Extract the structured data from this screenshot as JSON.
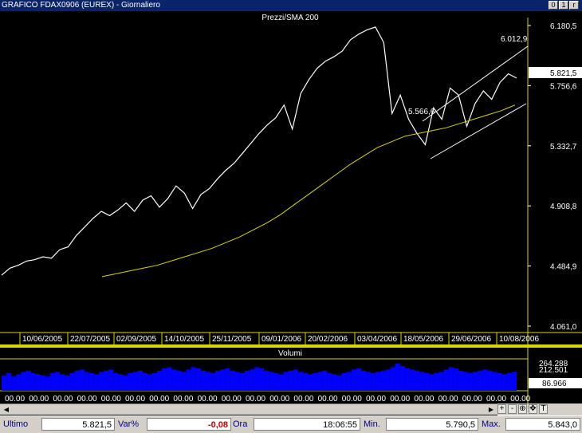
{
  "window": {
    "title": "GRAFICO FDAX0906 (EUREX) - Giornaliero",
    "buttons": [
      "0",
      "1",
      "r"
    ]
  },
  "chart_data": [
    {
      "type": "line",
      "title": "Prezzi/SMA 200",
      "series": [
        {
          "values": [
            4420,
            4470,
            4490,
            4520,
            4530,
            4550,
            4540,
            4600,
            4620,
            4700,
            4760,
            4820,
            4870,
            4840,
            4880,
            4930,
            4870,
            4950,
            4980,
            4900,
            4960,
            5050,
            5000,
            4890,
            4990,
            5030,
            5100,
            5160,
            5210,
            5280,
            5350,
            5420,
            5480,
            5530,
            5620,
            5450,
            5700,
            5800,
            5880,
            5930,
            5960,
            6000,
            6080,
            6120,
            6150,
            6170,
            6060,
            5560,
            5690,
            5520,
            5420,
            5340,
            5600,
            5520,
            5740,
            5690,
            5470,
            5630,
            5720,
            5660,
            5780,
            5840,
            5810
          ],
          "color": "#ffffff"
        },
        {
          "values": [
            4410,
            4430,
            4450,
            4470,
            4490,
            4520,
            4550,
            4580,
            4610,
            4650,
            4690,
            4740,
            4790,
            4850,
            4920,
            4990,
            5060,
            5130,
            5200,
            5260,
            5320,
            5360,
            5400,
            5420,
            5440,
            5460,
            5490,
            5520,
            5550,
            5580,
            5620
          ],
          "color": "#d8d800"
        }
      ],
      "y_ticks": [
        "6.180,5",
        "5.756,6",
        "5.332,7",
        "4.908,8",
        "4.484,9",
        "4.061,0"
      ],
      "x_ticks": [
        "10/06/2005",
        "22/07/2005",
        "02/09/2005",
        "14/10/2005",
        "25/11/2005",
        "09/01/2006",
        "20/02/2006",
        "03/04/2006",
        "18/05/2006",
        "29/06/2006",
        "10/08/2006"
      ],
      "annotations": [
        "6.012,9",
        "5.566,6"
      ],
      "last_value": "5.821,5",
      "ylim": [
        4061.0,
        6180.5
      ]
    },
    {
      "type": "bar",
      "title": "Volumi",
      "y_ticks": [
        "264.288",
        "212.501",
        "86.966"
      ],
      "x_ticks": [
        "00.00",
        "00.00",
        "00.00",
        "00.00",
        "00.00",
        "00.00",
        "00.00",
        "00.00",
        "00.00",
        "00.00",
        "00.00",
        "00.00",
        "00.00",
        "00.00",
        "00.00",
        "00.00",
        "00.00",
        "00.00",
        "00.00",
        "00.00",
        "00.00",
        "00.00"
      ],
      "values": [
        130,
        150,
        120,
        140,
        160,
        170,
        150,
        140,
        130,
        120,
        150,
        160,
        140,
        130,
        150,
        170,
        180,
        160,
        150,
        140,
        160,
        170,
        180,
        150,
        140,
        130,
        150,
        160,
        170,
        150,
        140,
        150,
        170,
        190,
        200,
        180,
        170,
        160,
        180,
        200,
        190,
        170,
        160,
        150,
        170,
        180,
        190,
        170,
        160,
        150,
        170,
        180,
        200,
        190,
        170,
        160,
        150,
        140,
        160,
        170,
        180,
        160,
        150,
        140,
        150,
        160,
        170,
        150,
        140,
        130,
        150,
        160,
        180,
        190,
        170,
        160,
        150,
        160,
        170,
        180,
        200,
        230,
        210,
        190,
        180,
        170,
        160,
        150,
        140,
        150,
        160,
        180,
        200,
        190,
        170,
        160,
        150,
        160,
        170,
        180,
        170,
        160,
        150,
        140,
        150,
        160
      ],
      "ylim": [
        0,
        264288
      ]
    }
  ],
  "status_bar": {
    "ultimo_label": "Ultimo",
    "ultimo_value": "5.821,5",
    "var_label": "Var%",
    "var_value": "-0,08",
    "ora_label": "Ora",
    "ora_value": "18:06:55",
    "min_label": "Min.",
    "min_value": "5.790,5",
    "max_label": "Max.",
    "max_value": "5.843,0"
  },
  "toolbar": {
    "tools": [
      "+",
      "-",
      "⊕",
      "✥",
      "T"
    ]
  },
  "colors": {
    "price_line": "#ffffff",
    "sma_line": "#d8d800",
    "volume_bars": "#0000ff",
    "separator": "#d8d800"
  }
}
